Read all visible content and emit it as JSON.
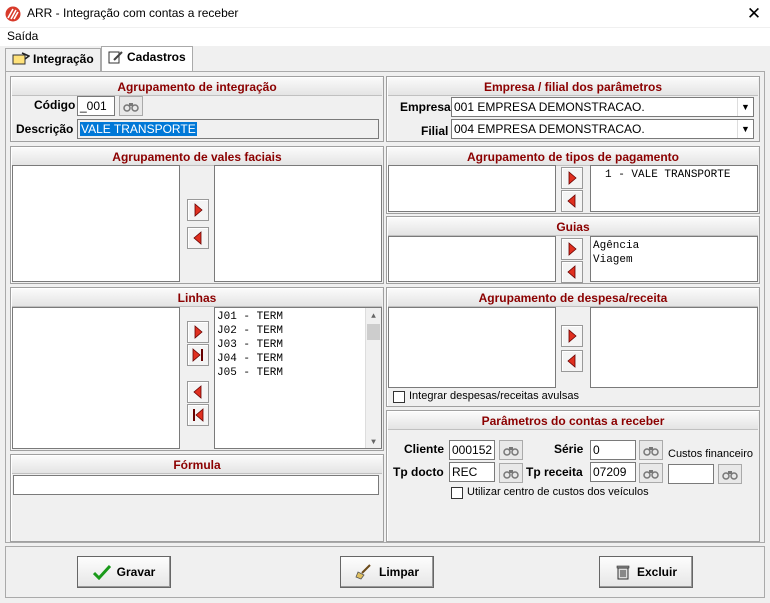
{
  "window": {
    "title": "ARR - Integração com contas a receber",
    "close_glyph": "✕"
  },
  "menu": {
    "saida": "Saída"
  },
  "tabs": [
    {
      "label": "Integração"
    },
    {
      "label": "Cadastros"
    }
  ],
  "agrupamento_integracao": {
    "header": "Agrupamento de integração",
    "codigo_label": "Código",
    "codigo_value": "_001",
    "descricao_label": "Descrição",
    "descricao_value": "VALE TRANSPORTE"
  },
  "empresa_filial": {
    "header": "Empresa / filial  dos parâmetros",
    "empresa_label": "Empresa",
    "empresa_value": "001 EMPRESA DEMONSTRACAO.",
    "filial_label": "Filial",
    "filial_value": "004 EMPRESA DEMONSTRACAO."
  },
  "vales_faciais": {
    "header": "Agrupamento de vales faciais"
  },
  "tipos_pagamento": {
    "header": "Agrupamento de tipos de pagamento",
    "right_items": [
      "1 - VALE TRANSPORTE"
    ]
  },
  "guias": {
    "header": "Guias",
    "right_items": [
      "Agência",
      "Viagem"
    ]
  },
  "linhas": {
    "header": "Linhas",
    "right_items": [
      "J01 - TERM",
      "J02 - TERM",
      "J03 - TERM",
      "J04 - TERM",
      "J05 - TERM"
    ]
  },
  "despesa_receita": {
    "header": "Agrupamento de despesa/receita",
    "checkbox_label": "Integrar despesas/receitas avulsas"
  },
  "formula": {
    "header": "Fórmula",
    "value": ""
  },
  "parametros": {
    "header": "Parâmetros do contas a receber",
    "cliente_label": "Cliente",
    "cliente_value": "000152",
    "serie_label": "Série",
    "serie_value": "0",
    "tp_docto_label": "Tp docto",
    "tp_docto_value": "REC",
    "tp_receita_label": "Tp receita",
    "tp_receita_value": "07209",
    "custos_label": "Custos financeiro",
    "custos_value": "",
    "checkbox_label": "Utilizar centro de custos dos veículos"
  },
  "buttons": {
    "gravar": "Gravar",
    "limpar": "Limpar",
    "excluir": "Excluir"
  },
  "colors": {
    "header_text": "#8b0000",
    "selection": "#0078d7",
    "arrow_fill": "#e03020"
  }
}
